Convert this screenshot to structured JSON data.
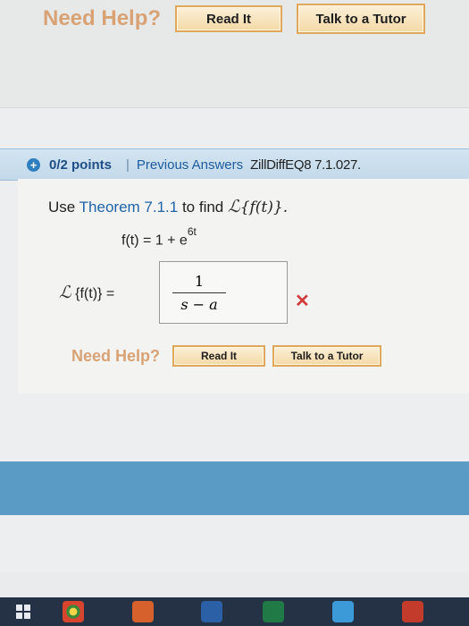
{
  "top_help": {
    "need_help": "Need Help?",
    "read_it": "Read It",
    "talk_tutor": "Talk to a Tutor"
  },
  "question": {
    "points": "0/2 points",
    "separator": "|",
    "previous_answers": "Previous Answers",
    "id": "ZillDiffEQ8 7.1.027.",
    "prompt_prefix": "Use",
    "theorem_link": "Theorem 7.1.1",
    "prompt_mid": "to find",
    "prompt_expr": "{f(t)}.",
    "laplace_symbol": "ℒ",
    "func_lhs": "f(t) = 1 + e",
    "func_exp": "6t",
    "answer_lhs": "{f(t)} =",
    "answer_num": "1",
    "answer_den": "s − a",
    "help": {
      "need_help": "Need Help?",
      "read_it": "Read It",
      "talk_tutor": "Talk to a Tutor"
    }
  },
  "icons": {
    "points": "plus-circle-icon",
    "wrong": "x-mark-icon"
  },
  "colors": {
    "header_bg": "#c9deee",
    "link": "#1e64a8",
    "need_help": "#d9a274",
    "wrong": "#d23b3b",
    "footer_band": "#5a9bc6"
  }
}
